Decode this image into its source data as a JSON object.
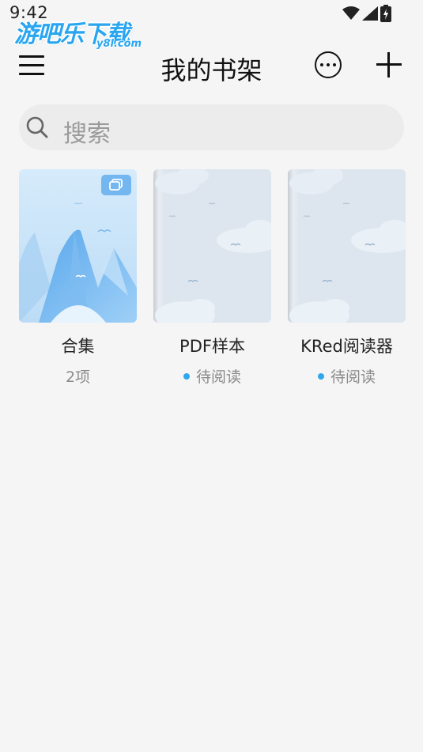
{
  "status_bar": {
    "time": "9:42"
  },
  "watermark": {
    "main": "游吧乐下载",
    "sub": "y8l.com"
  },
  "header": {
    "title": "我的书架"
  },
  "search": {
    "placeholder": "搜索"
  },
  "shelf": {
    "items": [
      {
        "title": "合集",
        "subtitle": "2项"
      },
      {
        "title": "PDF样本",
        "subtitle": "待阅读"
      },
      {
        "title": "KRed阅读器",
        "subtitle": "待阅读"
      }
    ]
  },
  "colors": {
    "background": "#f5f5f5",
    "accent": "#2ea7ee",
    "search_bg": "#ececec"
  },
  "icons": {
    "menu": "hamburger-icon",
    "more": "more-circle-icon",
    "add": "plus-icon",
    "search": "search-icon",
    "collection_badge": "stack-icon",
    "signal": "signal-icon",
    "wifi": "wifi-icon",
    "battery": "battery-icon"
  }
}
